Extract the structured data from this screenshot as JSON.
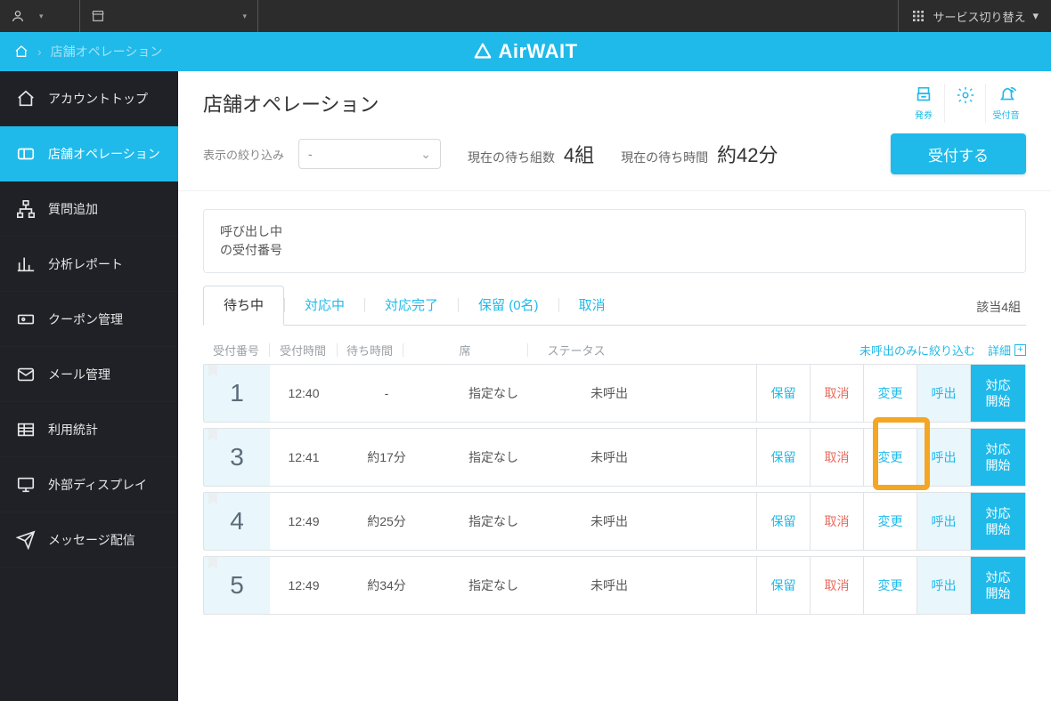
{
  "topbar": {
    "service_switch": "サービス切り替え"
  },
  "brand": {
    "name": "AirWAIT",
    "crumb": "店舗オペレーション"
  },
  "sidebar": {
    "items": [
      {
        "label": "アカウントトップ"
      },
      {
        "label": "店舗オペレーション"
      },
      {
        "label": "質問追加"
      },
      {
        "label": "分析レポート"
      },
      {
        "label": "クーポン管理"
      },
      {
        "label": "メール管理"
      },
      {
        "label": "利用統計"
      },
      {
        "label": "外部ディスプレイ"
      },
      {
        "label": "メッセージ配信"
      }
    ]
  },
  "page": {
    "title": "店舗オペレーション",
    "icon_ticket": "発券",
    "icon_sound": "受付音"
  },
  "filter": {
    "label": "表示の絞り込み",
    "select_value": "-",
    "stat1_label": "現在の待ち組数",
    "stat1_value": "4組",
    "stat2_label": "現在の待ち時間",
    "stat2_value": "約42分",
    "primary": "受付する"
  },
  "calling": {
    "line1": "呼び出し中",
    "line2": "の受付番号"
  },
  "tabs": {
    "items": [
      "待ち中",
      "対応中",
      "対応完了",
      "保留 (0名)",
      "取消"
    ],
    "right": "該当4組"
  },
  "cols": {
    "num": "受付番号",
    "time": "受付時間",
    "wait": "待ち時間",
    "seat": "席",
    "status": "ステータス",
    "filter_link": "未呼出のみに絞り込む",
    "detail_link": "詳細"
  },
  "actions": {
    "hold": "保留",
    "cancel": "取消",
    "edit": "変更",
    "call": "呼出",
    "start": "対応\n開始"
  },
  "rows": [
    {
      "num": "1",
      "time": "12:40",
      "wait": "-",
      "seat": "指定なし",
      "status": "未呼出"
    },
    {
      "num": "3",
      "time": "12:41",
      "wait": "約17分",
      "seat": "指定なし",
      "status": "未呼出"
    },
    {
      "num": "4",
      "time": "12:49",
      "wait": "約25分",
      "seat": "指定なし",
      "status": "未呼出"
    },
    {
      "num": "5",
      "time": "12:49",
      "wait": "約34分",
      "seat": "指定なし",
      "status": "未呼出"
    }
  ]
}
